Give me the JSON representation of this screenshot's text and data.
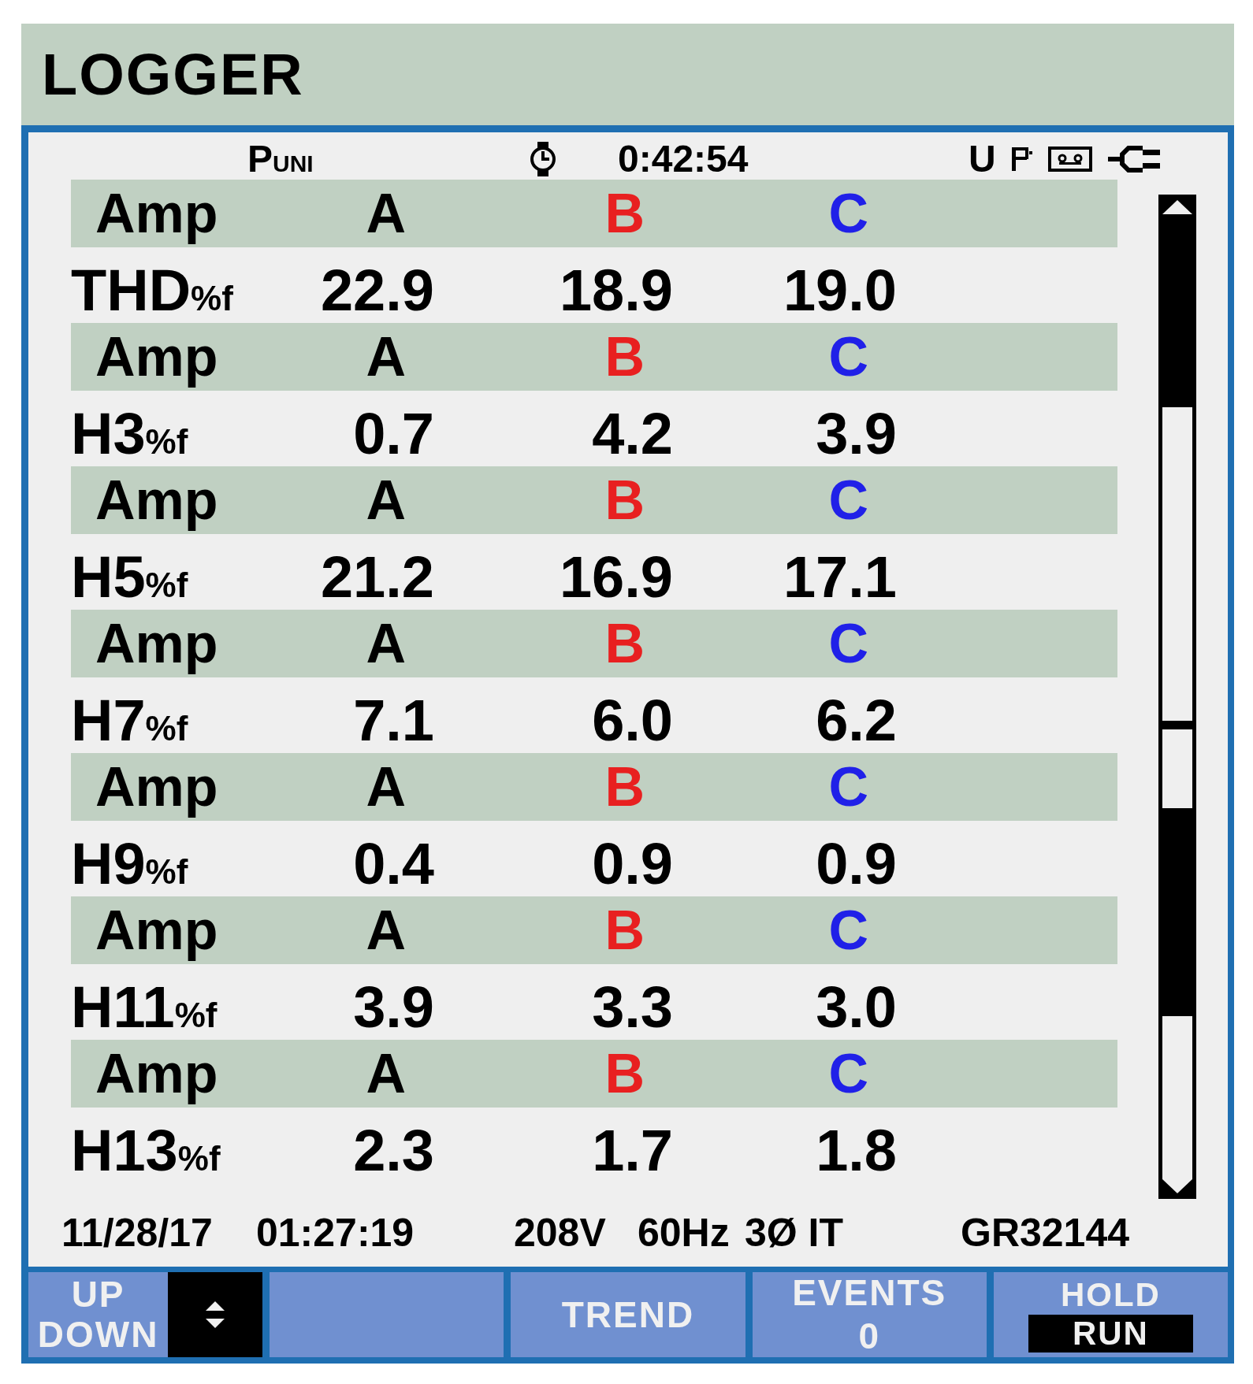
{
  "title": "LOGGER",
  "status": {
    "quantity": {
      "label": "P",
      "suffix": "UNI"
    },
    "elapsed": "0:42:54",
    "indicator": "U"
  },
  "table": {
    "rows": [
      {
        "kind": "header",
        "label": "Amp",
        "cells": [
          {
            "text": "A",
            "color": "#000000"
          },
          {
            "text": "B",
            "color": "#e82020"
          },
          {
            "text": "C",
            "color": "#2020e8"
          }
        ]
      },
      {
        "kind": "values",
        "label": "THD",
        "unit": "%f",
        "cells": [
          "22.9",
          "18.9",
          "19.0"
        ]
      },
      {
        "kind": "header",
        "label": "Amp",
        "cells": [
          {
            "text": "A",
            "color": "#000000"
          },
          {
            "text": "B",
            "color": "#e82020"
          },
          {
            "text": "C",
            "color": "#2020e8"
          }
        ]
      },
      {
        "kind": "values",
        "label": "H3",
        "unit": "%f",
        "cells": [
          "0.7",
          "4.2",
          "3.9"
        ]
      },
      {
        "kind": "header",
        "label": "Amp",
        "cells": [
          {
            "text": "A",
            "color": "#000000"
          },
          {
            "text": "B",
            "color": "#e82020"
          },
          {
            "text": "C",
            "color": "#2020e8"
          }
        ]
      },
      {
        "kind": "values",
        "label": "H5",
        "unit": "%f",
        "cells": [
          "21.2",
          "16.9",
          "17.1"
        ]
      },
      {
        "kind": "header",
        "label": "Amp",
        "cells": [
          {
            "text": "A",
            "color": "#000000"
          },
          {
            "text": "B",
            "color": "#e82020"
          },
          {
            "text": "C",
            "color": "#2020e8"
          }
        ]
      },
      {
        "kind": "values",
        "label": "H7",
        "unit": "%f",
        "cells": [
          "7.1",
          "6.0",
          "6.2"
        ]
      },
      {
        "kind": "header",
        "label": "Amp",
        "cells": [
          {
            "text": "A",
            "color": "#000000"
          },
          {
            "text": "B",
            "color": "#e82020"
          },
          {
            "text": "C",
            "color": "#2020e8"
          }
        ]
      },
      {
        "kind": "values",
        "label": "H9",
        "unit": "%f",
        "cells": [
          "0.4",
          "0.9",
          "0.9"
        ]
      },
      {
        "kind": "header",
        "label": "Amp",
        "cells": [
          {
            "text": "A",
            "color": "#000000"
          },
          {
            "text": "B",
            "color": "#e82020"
          },
          {
            "text": "C",
            "color": "#2020e8"
          }
        ]
      },
      {
        "kind": "values",
        "label": "H11",
        "unit": "%f",
        "cells": [
          "3.9",
          "3.3",
          "3.0"
        ]
      },
      {
        "kind": "header",
        "label": "Amp",
        "cells": [
          {
            "text": "A",
            "color": "#000000"
          },
          {
            "text": "B",
            "color": "#e82020"
          },
          {
            "text": "C",
            "color": "#2020e8"
          }
        ]
      },
      {
        "kind": "values",
        "label": "H13",
        "unit": "%f",
        "cells": [
          "2.3",
          "1.7",
          "1.8"
        ]
      }
    ]
  },
  "footer": [
    "11/28/17",
    "01:27:19",
    "208V",
    "60Hz",
    "3Ø IT",
    "GR32144"
  ],
  "softkeys": [
    {
      "kind": "updown",
      "lines": [
        "UP",
        "DOWN"
      ]
    },
    {
      "kind": "blank"
    },
    {
      "kind": "label",
      "lines": [
        "TREND"
      ]
    },
    {
      "kind": "label",
      "lines": [
        "EVENTS",
        "0"
      ]
    },
    {
      "kind": "toggle",
      "options": [
        {
          "text": "HOLD",
          "selected": false
        },
        {
          "text": "RUN",
          "selected": true
        }
      ]
    }
  ]
}
